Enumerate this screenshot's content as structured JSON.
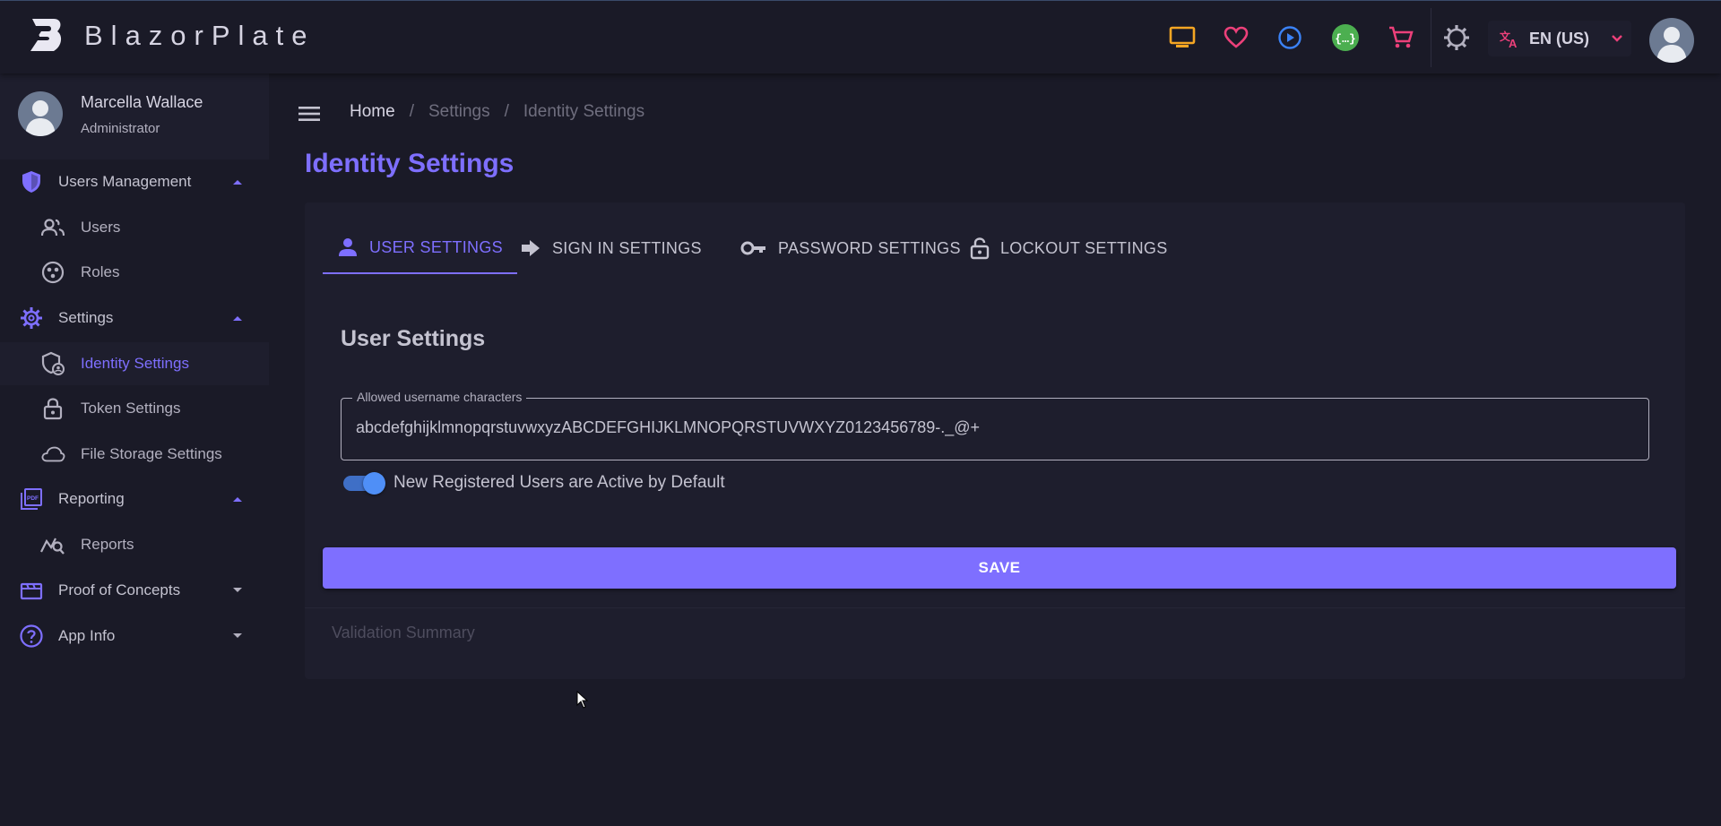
{
  "app": {
    "brand": "BlazorPlate",
    "language": "EN (US)"
  },
  "colors": {
    "accent": "#7e6fff",
    "background": "#1a1a27",
    "surface": "#1e1e2d",
    "toggle": "#4f8ff7"
  },
  "appbar": {
    "icons": [
      "monitor-icon",
      "heart-icon",
      "play-circle-icon",
      "api-icon",
      "cart-icon",
      "settings-gear-icon",
      "translate-icon"
    ]
  },
  "sidebar": {
    "user_name": "Marcella Wallace",
    "user_role": "Administrator",
    "items": [
      {
        "label": "Users Management",
        "icon": "shield-icon",
        "type": "group",
        "expanded": true
      },
      {
        "label": "Users",
        "icon": "users-icon",
        "type": "sub"
      },
      {
        "label": "Roles",
        "icon": "roles-icon",
        "type": "sub"
      },
      {
        "label": "Settings",
        "icon": "gear-icon",
        "type": "group",
        "expanded": true
      },
      {
        "label": "Identity Settings",
        "icon": "identity-shield-icon",
        "type": "sub",
        "active": true
      },
      {
        "label": "Token Settings",
        "icon": "lock-icon",
        "type": "sub"
      },
      {
        "label": "File Storage Settings",
        "icon": "cloud-icon",
        "type": "sub"
      },
      {
        "label": "Reporting",
        "icon": "pdf-icon",
        "type": "group",
        "expanded": true
      },
      {
        "label": "Reports",
        "icon": "chart-search-icon",
        "type": "sub"
      },
      {
        "label": "Proof of Concepts",
        "icon": "movie-icon",
        "type": "group",
        "expanded": false
      },
      {
        "label": "App Info",
        "icon": "help-icon",
        "type": "group",
        "expanded": false
      }
    ]
  },
  "breadcrumb": {
    "home": "Home",
    "settings": "Settings",
    "current": "Identity Settings",
    "separator": "/"
  },
  "page": {
    "title": "Identity Settings"
  },
  "tabs": [
    {
      "label": "USER SETTINGS",
      "icon": "person-icon",
      "active": true
    },
    {
      "label": "SIGN IN SETTINGS",
      "icon": "arrow-right-icon",
      "active": false
    },
    {
      "label": "PASSWORD SETTINGS",
      "icon": "key-icon",
      "active": false
    },
    {
      "label": "LOCKOUT SETTINGS",
      "icon": "lock-outline-icon",
      "active": false
    }
  ],
  "user_settings": {
    "title": "User Settings",
    "allowed_chars_label": "Allowed username characters",
    "allowed_chars_value": "abcdefghijklmnopqrstuvwxyzABCDEFGHIJKLMNOPQRSTUVWXYZ0123456789-._@+",
    "active_default_label": "New Registered Users are Active by Default",
    "active_default_on": true
  },
  "actions": {
    "save": "SAVE"
  },
  "validation": {
    "summary": "Validation Summary"
  }
}
